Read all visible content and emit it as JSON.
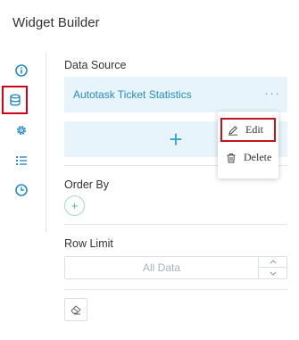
{
  "header": {
    "title": "Widget Builder"
  },
  "sidebar": {
    "items": [
      {
        "icon": "info-icon"
      },
      {
        "icon": "database-icon",
        "active": true
      },
      {
        "icon": "gear-icon"
      },
      {
        "icon": "list-icon"
      },
      {
        "icon": "clock-icon"
      }
    ]
  },
  "data_source": {
    "label": "Data Source",
    "selected": "Autotask Ticket Statistics",
    "more": "···",
    "add_symbol": "+"
  },
  "context_menu": {
    "items": [
      {
        "label": "Edit",
        "icon": "edit-icon"
      },
      {
        "label": "Delete",
        "icon": "trash-icon"
      }
    ]
  },
  "order_by": {
    "label": "Order By",
    "add_symbol": "+"
  },
  "row_limit": {
    "label": "Row Limit",
    "placeholder": "All Data",
    "value": ""
  },
  "colors": {
    "accent": "#2a8bc2",
    "panel_bg": "#e7f4fb",
    "highlight_border": "#d0021b",
    "icon": "#2a8bc2",
    "add_green": "#4db585"
  }
}
